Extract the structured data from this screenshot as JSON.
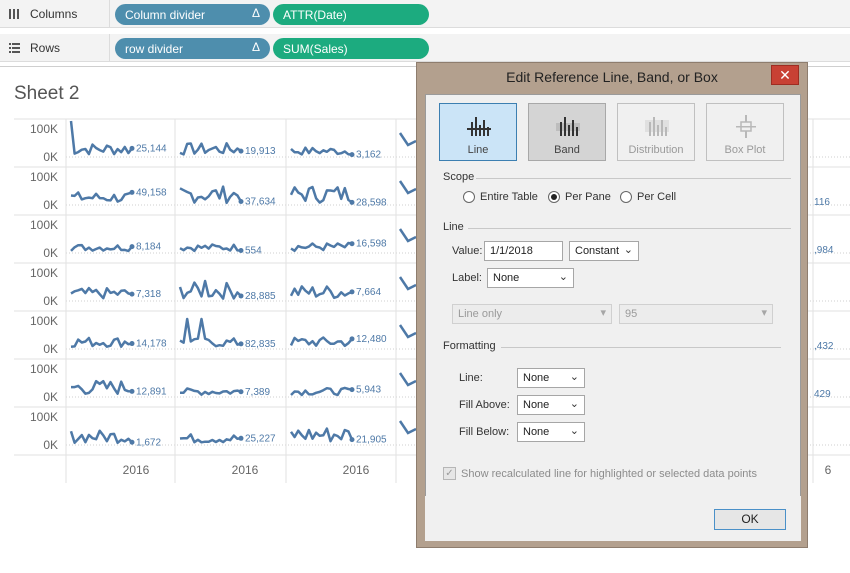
{
  "shelves": {
    "columns": {
      "label": "Columns",
      "pills": [
        "Column divider",
        "ATTR(Date)"
      ]
    },
    "rows": {
      "label": "Rows",
      "pills": [
        "row divider",
        "SUM(Sales)"
      ]
    },
    "delta_symbol": "Δ"
  },
  "sheet": {
    "title": "Sheet 2"
  },
  "viz": {
    "y_ticks": [
      "100K",
      "0K"
    ],
    "x_labels": [
      "2016",
      "2016",
      "2016",
      "6"
    ],
    "cell_labels": [
      [
        "25,144",
        "19,913",
        "3,162"
      ],
      [
        "49,158",
        "37,634",
        "28,598"
      ],
      [
        "8,184",
        "554",
        "16,598"
      ],
      [
        "7,318",
        "28,885",
        "7,664"
      ],
      [
        "14,178",
        "82,835",
        "12,480"
      ],
      [
        "12,891",
        "7,389",
        "5,943"
      ],
      [
        "1,672",
        "25,227",
        "21,905"
      ]
    ],
    "right_edge_labels": [
      "",
      "116",
      ",984",
      "",
      ",432",
      "429",
      ""
    ],
    "line_color": "#4e79a7"
  },
  "dialog": {
    "title": "Edit Reference Line, Band, or Box",
    "close_symbol": "✕",
    "types": [
      {
        "label": "Line",
        "state": "active"
      },
      {
        "label": "Band",
        "state": "pressed"
      },
      {
        "label": "Distribution",
        "state": "disabled"
      },
      {
        "label": "Box Plot",
        "state": "disabled"
      }
    ],
    "scope": {
      "heading": "Scope",
      "options": [
        "Entire Table",
        "Per Pane",
        "Per Cell"
      ],
      "selected": "Per Pane"
    },
    "line": {
      "heading": "Line",
      "value_label": "Value:",
      "value": "1/1/2018",
      "value_type": "Constant",
      "label_label": "Label:",
      "label_value": "None",
      "disabled_select_1": "Line only",
      "disabled_select_2": "95"
    },
    "formatting": {
      "heading": "Formatting",
      "line_label": "Line:",
      "line_value": "None",
      "fill_above_label": "Fill Above:",
      "fill_above_value": "None",
      "fill_below_label": "Fill Below:",
      "fill_below_value": "None"
    },
    "checkbox_label": "Show recalculated line for highlighted or selected data points",
    "ok_label": "OK"
  }
}
